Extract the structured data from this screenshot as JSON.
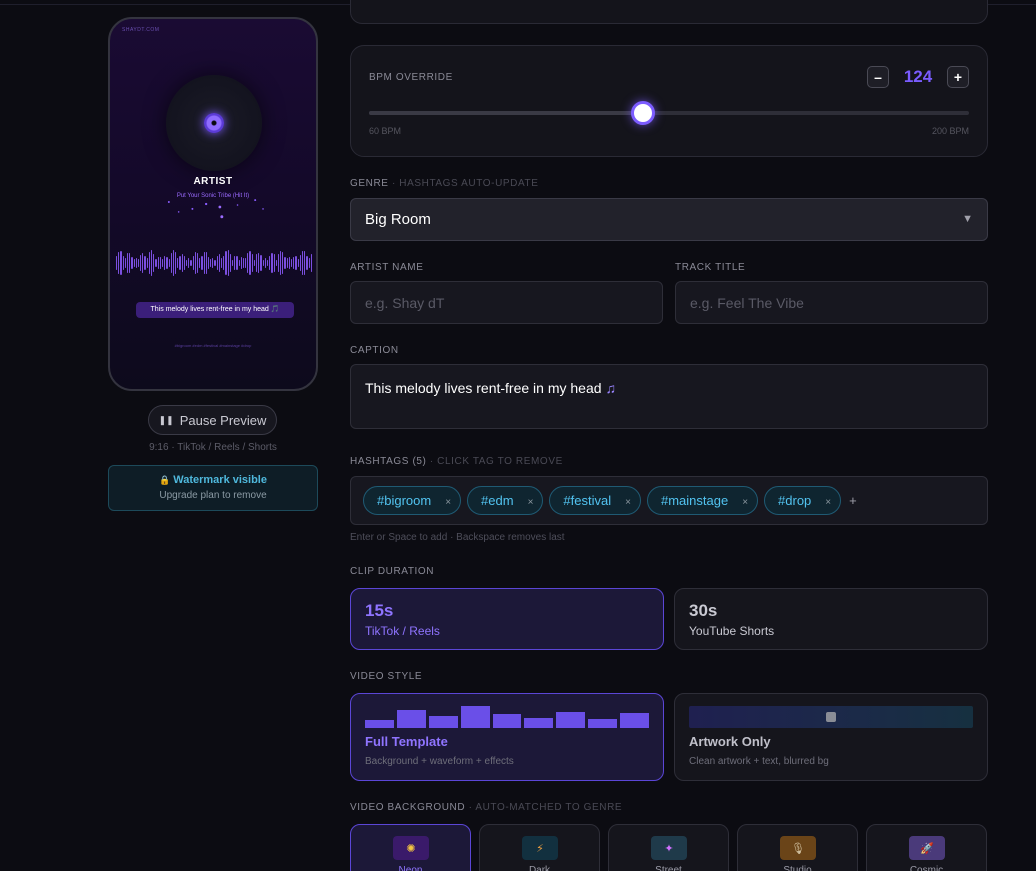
{
  "preview": {
    "brand": "SHAYDT.COM",
    "artist": "ARTIST",
    "track_title": "Put Your Sonic Tribe (Hit It)",
    "caption": "This melody lives rent-free in my head 🎵",
    "hashtags": "#bigroom #edm #festival #mainstage #drop",
    "pause_label": "Pause Preview",
    "format_note": "9:16 · TikTok / Reels / Shorts",
    "watermark_title": "Watermark visible",
    "watermark_sub": "Upgrade plan to remove",
    "progress": 0.2
  },
  "bpm": {
    "label": "BPM OVERRIDE",
    "value": "124",
    "min_label": "60 BPM",
    "max_label": "200 BPM",
    "min": 60,
    "max": 200,
    "current": 124,
    "minus": "–",
    "plus": "+"
  },
  "genre": {
    "label": "GENRE",
    "hint": "· HASHTAGS AUTO-UPDATE",
    "selected": "Big Room"
  },
  "artist_field": {
    "label": "ARTIST NAME",
    "placeholder": "e.g. Shay dT",
    "value": ""
  },
  "track_field": {
    "label": "TRACK TITLE",
    "placeholder": "e.g. Feel The Vibe",
    "value": ""
  },
  "caption": {
    "label": "CAPTION",
    "value": "This melody lives rent-free in my head",
    "icon": "♫"
  },
  "hashtags": {
    "label": "HASHTAGS (5)",
    "hint": "· CLICK TAG TO REMOVE",
    "tags": [
      "#bigroom",
      "#edm",
      "#festival",
      "#mainstage",
      "#drop"
    ],
    "remove_glyph": "×",
    "add_glyph": "+",
    "note": "Enter or Space to add · Backspace removes last"
  },
  "duration": {
    "label": "CLIP DURATION",
    "options": [
      {
        "value": "15s",
        "sub": "TikTok / Reels",
        "selected": true
      },
      {
        "value": "30s",
        "sub": "YouTube Shorts",
        "selected": false
      }
    ]
  },
  "video_style": {
    "label": "VIDEO STYLE",
    "options": [
      {
        "name": "Full Template",
        "desc": "Background + waveform + effects",
        "selected": true
      },
      {
        "name": "Artwork Only",
        "desc": "Clean artwork + text, blurred bg",
        "selected": false
      }
    ]
  },
  "background": {
    "label": "VIDEO BACKGROUND",
    "hint": "· AUTO-MATCHED TO GENRE",
    "options": [
      {
        "name": "Neon",
        "icon": "✺",
        "icon_name": "sparkle-icon",
        "color": "#3a1a6a",
        "glyph_color": "#f5c542",
        "selected": true
      },
      {
        "name": "Dark",
        "icon": "⚡",
        "icon_name": "lightning-icon",
        "color": "#12303f",
        "glyph_color": "#f0a040",
        "selected": false
      },
      {
        "name": "Street",
        "icon": "✦",
        "icon_name": "street-icon",
        "color": "#1f3a4a",
        "glyph_color": "#d070ff",
        "selected": false
      },
      {
        "name": "Studio",
        "icon": "🎙",
        "icon_name": "microphone-icon",
        "color": "#6a4418",
        "glyph_color": "#d0c0a0",
        "selected": false
      },
      {
        "name": "Cosmic",
        "icon": "🚀",
        "icon_name": "rocket-icon",
        "color": "#4a3a7a",
        "glyph_color": "#80c0ff",
        "selected": false
      }
    ]
  },
  "colors": {
    "accent": "#7c5cff",
    "tag_text": "#52c3f0",
    "watermark_text": "#4fb8dc"
  }
}
